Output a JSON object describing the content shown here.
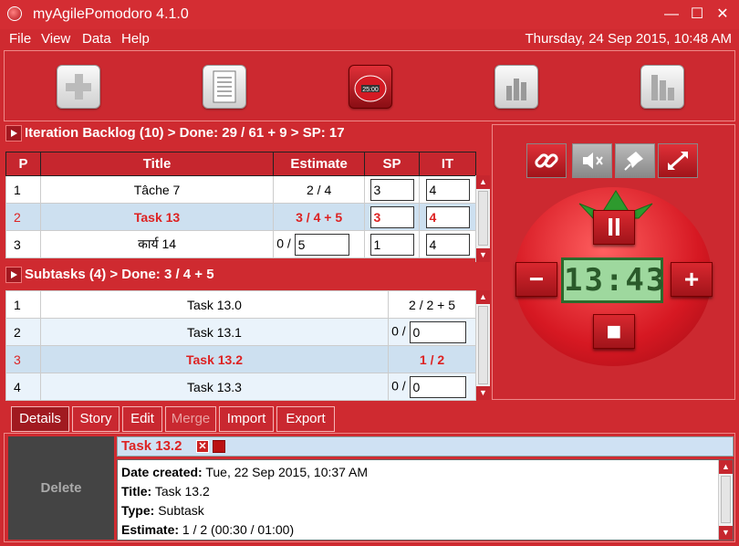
{
  "window": {
    "title": "myAgilePomodoro 4.1.0",
    "min": "—",
    "max": "☐",
    "close": "✕"
  },
  "menu": {
    "items": [
      "File",
      "View",
      "Data",
      "Help"
    ],
    "datetime": "Thursday, 24 Sep 2015, 10:48 AM"
  },
  "toolbar": {
    "buttons": [
      "add-icon",
      "document-icon",
      "pomodoro-timer-icon",
      "chart-icon",
      "bar-chart-icon"
    ],
    "timer_label": "25:00"
  },
  "backlog": {
    "header": "Iteration Backlog (10) > Done: 29 / 61 + 9 > SP: 17",
    "columns": [
      "P",
      "Title",
      "Estimate",
      "SP",
      "IT"
    ],
    "rows": [
      {
        "p": "1",
        "title": "Tâche 7",
        "estimate": "2 / 4",
        "sp": "3",
        "it": "4"
      },
      {
        "p": "2",
        "title": "Task 13",
        "estimate": "3 / 4 + 5",
        "sp": "3",
        "it": "4"
      },
      {
        "p": "3",
        "title": "कार्य 14",
        "estimate_prefix": "0 /",
        "estimate_value": "5",
        "sp": "1",
        "it": "4"
      }
    ]
  },
  "subtasks": {
    "header": "Subtasks (4) > Done: 3 / 4 + 5",
    "rows": [
      {
        "p": "1",
        "title": "Task 13.0",
        "estimate": "2 / 2 + 5"
      },
      {
        "p": "2",
        "title": "Task 13.1",
        "estimate_prefix": "0 /",
        "estimate_value": "0"
      },
      {
        "p": "3",
        "title": "Task 13.2",
        "estimate": "1 / 2"
      },
      {
        "p": "4",
        "title": "Task 13.3",
        "estimate_prefix": "0 /",
        "estimate_value": "0"
      }
    ]
  },
  "timer": {
    "display": "13:43",
    "pause": "II",
    "minus": "−",
    "plus": "+",
    "stop": "■"
  },
  "tabs": [
    "Details",
    "Story",
    "Edit",
    "Merge",
    "Import",
    "Export"
  ],
  "details": {
    "delete_label": "Delete",
    "title": "Task 13.2",
    "lines": [
      {
        "label": "Date created:",
        "value": " Tue, 22 Sep 2015, 10:37 AM"
      },
      {
        "label": "Title:",
        "value": " Task 13.2"
      },
      {
        "label": "Type:",
        "value": " Subtask"
      },
      {
        "label": "Estimate:",
        "value": " 1 / 2 (00:30 / 01:00)"
      }
    ]
  },
  "colors": {
    "accent": "#cf2a30",
    "selected_row": "#cde0f0",
    "clock_bg": "#9ed89e"
  }
}
